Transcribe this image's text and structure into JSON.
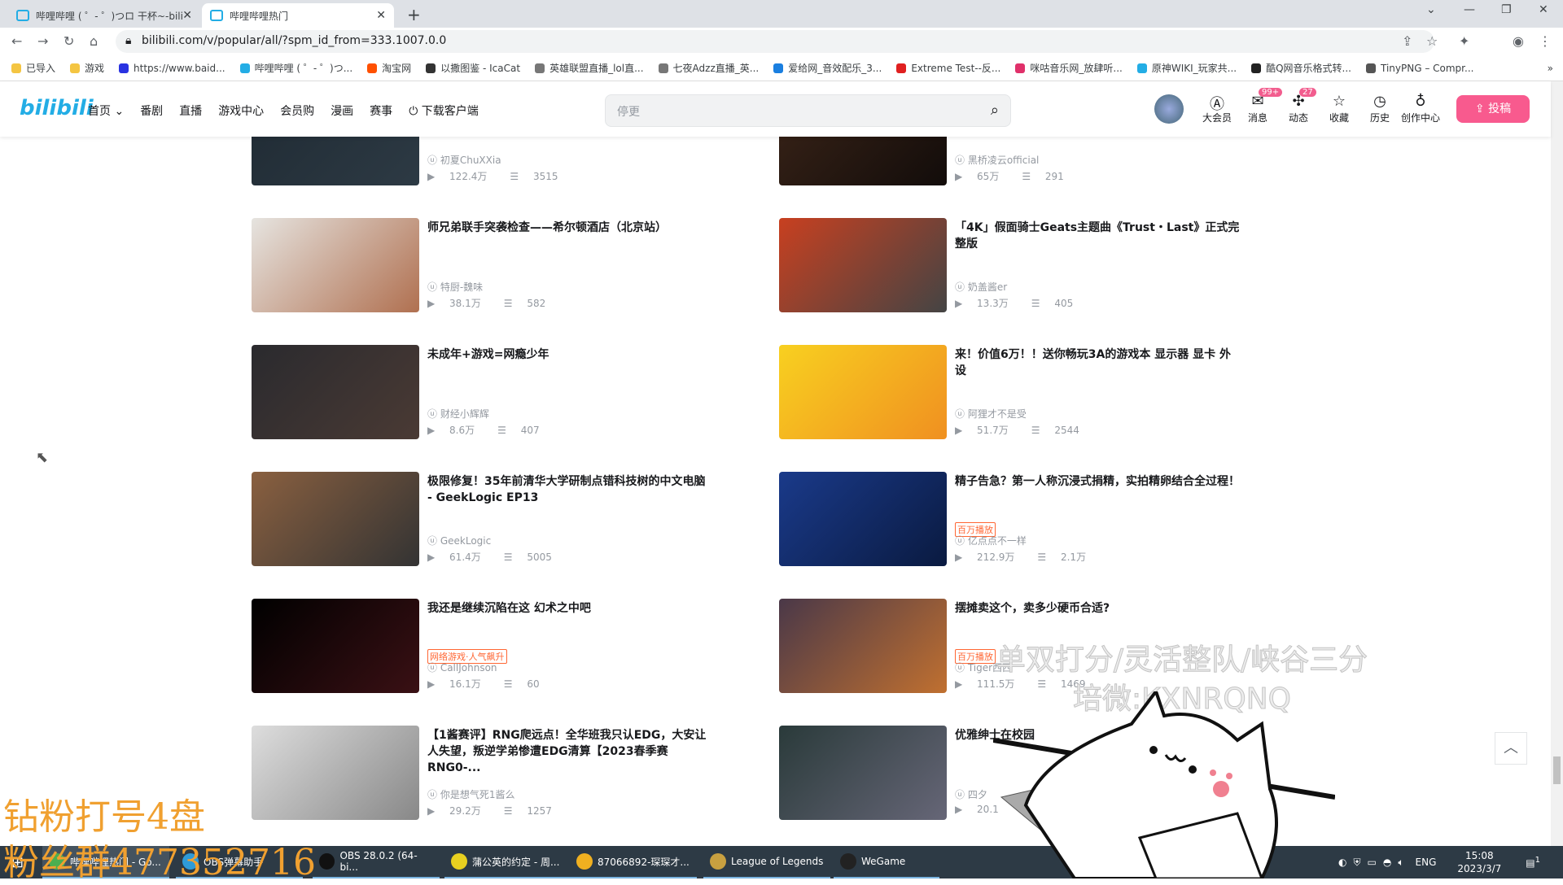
{
  "browser": {
    "tabs": [
      {
        "title": "哔哩哔哩 ( ゜- ゜)つロ 干杯~-bili"
      },
      {
        "title": "哔哩哔哩热门"
      }
    ],
    "url": "bilibili.com/v/popular/all/?spm_id_from=333.1007.0.0",
    "bookmarks": [
      "已导入",
      "游戏",
      "https://www.baid...",
      "哔哩哔哩 ( ゜- ゜)つ...",
      "淘宝网",
      "以撒图鉴 - IcaCat",
      "英雄联盟直播_lol直...",
      "七夜Adzz直播_英...",
      "爱给网_音效配乐_3...",
      "Extreme Test--反...",
      "咪咕音乐网_放肆听...",
      "原神WIKI_玩家共...",
      "酷Q网音乐格式转...",
      "TinyPNG – Compr..."
    ]
  },
  "header": {
    "logo": "bilibili",
    "nav": [
      "首页 ⌄",
      "番剧",
      "直播",
      "游戏中心",
      "会员购",
      "漫画",
      "赛事",
      "⏻ 下载客户端"
    ],
    "search_placeholder": "停更",
    "icons": [
      {
        "label": "大会员",
        "glyph": "Ⓐ"
      },
      {
        "label": "消息",
        "glyph": "✉",
        "badge": "99+"
      },
      {
        "label": "动态",
        "glyph": "✣",
        "badge": "27"
      },
      {
        "label": "收藏",
        "glyph": "☆"
      },
      {
        "label": "历史",
        "glyph": "◷"
      },
      {
        "label": "创作中心",
        "glyph": "♁"
      }
    ],
    "upload": "⇪ 投稿"
  },
  "videos": [
    {
      "title": "",
      "tag": "",
      "up": "初夏ChuXXia",
      "views": "122.4万",
      "danmaku": "3515",
      "thumb": [
        "#1f2a33",
        "#2d3a44"
      ]
    },
    {
      "title": "",
      "tag": "",
      "up": "黑桥凌云official",
      "views": "65万",
      "danmaku": "291",
      "thumb": [
        "#3a2418",
        "#120c0a"
      ]
    },
    {
      "title": "师兄弟联手突袭检查——希尔顿酒店（北京站）",
      "tag": "",
      "up": "特厨-魏味",
      "views": "38.1万",
      "danmaku": "582",
      "thumb": [
        "#e6e4e0",
        "#b07050"
      ]
    },
    {
      "title": "「4K」假面骑士Geats主题曲《Trust・Last》正式完整版",
      "tag": "",
      "up": "奶盖酱er",
      "views": "13.3万",
      "danmaku": "405",
      "thumb": [
        "#c84020",
        "#444"
      ]
    },
    {
      "title": "未成年+游戏=网瘾少年",
      "tag": "",
      "up": "财经小辉辉",
      "views": "8.6万",
      "danmaku": "407",
      "thumb": [
        "#2a2a2e",
        "#4a3a34"
      ]
    },
    {
      "title": "来！价值6万！！送你畅玩3A的游戏本 显示器 显卡 外设",
      "tag": "",
      "up": "阿狸才不是受",
      "views": "51.7万",
      "danmaku": "2544",
      "thumb": [
        "#f8d020",
        "#f09020"
      ]
    },
    {
      "title": "极限修复！35年前清华大学研制点错科技树的中文电脑 - GeekLogic EP13",
      "tag": "",
      "up": "GeekLogic",
      "views": "61.4万",
      "danmaku": "5005",
      "thumb": [
        "#8a6040",
        "#333"
      ]
    },
    {
      "title": "精子告急？第一人称沉浸式捐精，实拍精卵结合全过程！",
      "tag": "百万播放",
      "up": "亿点点不一样",
      "views": "212.9万",
      "danmaku": "2.1万",
      "thumb": [
        "#1a3a8a",
        "#0a1a40"
      ]
    },
    {
      "title": "我还是继续沉陷在这 幻术之中吧",
      "tag": "网络游戏·人气飙升",
      "up": "CallJohnson",
      "views": "16.1万",
      "danmaku": "60",
      "thumb": [
        "#000",
        "#3a1014"
      ]
    },
    {
      "title": "摆摊卖这个，卖多少硬币合适?",
      "tag": "百万播放",
      "up": "Tiger西西",
      "views": "111.5万",
      "danmaku": "1469",
      "thumb": [
        "#4a3848",
        "#c07030"
      ]
    },
    {
      "title": "【1酱赛评】RNG爬远点！全华班我只认EDG，大安让人失望，叛逆学弟惨遭EDG清算【2023春季赛 RNG0-...",
      "tag": "",
      "up": "你是想气死1酱么",
      "views": "29.2万",
      "danmaku": "1257",
      "thumb": [
        "#ddd",
        "#888"
      ]
    },
    {
      "title": "优雅绅士在校园",
      "tag": "",
      "up": "四夕",
      "views": "20.1",
      "danmaku": "",
      "thumb": [
        "#2a3a3a",
        "#667"
      ]
    }
  ],
  "back_to_top": "︿",
  "overlays": {
    "left1": "钻粉打号4盘",
    "left2": "粉丝群477352716",
    "ghost1": "单双打分/灵活整队/峡谷三分",
    "ghost2": "培微:KXNRQNQ"
  },
  "taskbar": {
    "items": [
      "哔哩哔哩热门 - Go...",
      "OBS弹幕助手",
      "OBS 28.0.2 (64-bi...",
      "蒲公英的约定 - 周...",
      "87066892-琛琛才...",
      "League of Legends",
      "WeGame"
    ],
    "lang": "ENG",
    "time": "15:08",
    "date": "2023/3/7",
    "notifications": "1"
  }
}
